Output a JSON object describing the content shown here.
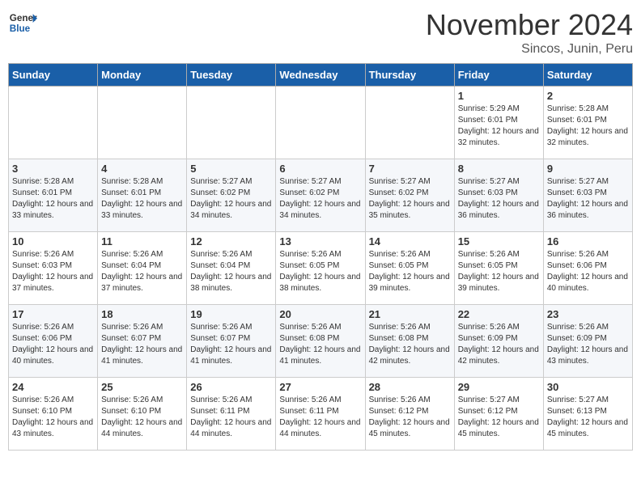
{
  "header": {
    "logo_general": "General",
    "logo_blue": "Blue",
    "month_title": "November 2024",
    "subtitle": "Sincos, Junin, Peru"
  },
  "days_of_week": [
    "Sunday",
    "Monday",
    "Tuesday",
    "Wednesday",
    "Thursday",
    "Friday",
    "Saturday"
  ],
  "weeks": [
    [
      {
        "day": "",
        "info": ""
      },
      {
        "day": "",
        "info": ""
      },
      {
        "day": "",
        "info": ""
      },
      {
        "day": "",
        "info": ""
      },
      {
        "day": "",
        "info": ""
      },
      {
        "day": "1",
        "info": "Sunrise: 5:29 AM\nSunset: 6:01 PM\nDaylight: 12 hours and 32 minutes."
      },
      {
        "day": "2",
        "info": "Sunrise: 5:28 AM\nSunset: 6:01 PM\nDaylight: 12 hours and 32 minutes."
      }
    ],
    [
      {
        "day": "3",
        "info": "Sunrise: 5:28 AM\nSunset: 6:01 PM\nDaylight: 12 hours and 33 minutes."
      },
      {
        "day": "4",
        "info": "Sunrise: 5:28 AM\nSunset: 6:01 PM\nDaylight: 12 hours and 33 minutes."
      },
      {
        "day": "5",
        "info": "Sunrise: 5:27 AM\nSunset: 6:02 PM\nDaylight: 12 hours and 34 minutes."
      },
      {
        "day": "6",
        "info": "Sunrise: 5:27 AM\nSunset: 6:02 PM\nDaylight: 12 hours and 34 minutes."
      },
      {
        "day": "7",
        "info": "Sunrise: 5:27 AM\nSunset: 6:02 PM\nDaylight: 12 hours and 35 minutes."
      },
      {
        "day": "8",
        "info": "Sunrise: 5:27 AM\nSunset: 6:03 PM\nDaylight: 12 hours and 36 minutes."
      },
      {
        "day": "9",
        "info": "Sunrise: 5:27 AM\nSunset: 6:03 PM\nDaylight: 12 hours and 36 minutes."
      }
    ],
    [
      {
        "day": "10",
        "info": "Sunrise: 5:26 AM\nSunset: 6:03 PM\nDaylight: 12 hours and 37 minutes."
      },
      {
        "day": "11",
        "info": "Sunrise: 5:26 AM\nSunset: 6:04 PM\nDaylight: 12 hours and 37 minutes."
      },
      {
        "day": "12",
        "info": "Sunrise: 5:26 AM\nSunset: 6:04 PM\nDaylight: 12 hours and 38 minutes."
      },
      {
        "day": "13",
        "info": "Sunrise: 5:26 AM\nSunset: 6:05 PM\nDaylight: 12 hours and 38 minutes."
      },
      {
        "day": "14",
        "info": "Sunrise: 5:26 AM\nSunset: 6:05 PM\nDaylight: 12 hours and 39 minutes."
      },
      {
        "day": "15",
        "info": "Sunrise: 5:26 AM\nSunset: 6:05 PM\nDaylight: 12 hours and 39 minutes."
      },
      {
        "day": "16",
        "info": "Sunrise: 5:26 AM\nSunset: 6:06 PM\nDaylight: 12 hours and 40 minutes."
      }
    ],
    [
      {
        "day": "17",
        "info": "Sunrise: 5:26 AM\nSunset: 6:06 PM\nDaylight: 12 hours and 40 minutes."
      },
      {
        "day": "18",
        "info": "Sunrise: 5:26 AM\nSunset: 6:07 PM\nDaylight: 12 hours and 41 minutes."
      },
      {
        "day": "19",
        "info": "Sunrise: 5:26 AM\nSunset: 6:07 PM\nDaylight: 12 hours and 41 minutes."
      },
      {
        "day": "20",
        "info": "Sunrise: 5:26 AM\nSunset: 6:08 PM\nDaylight: 12 hours and 41 minutes."
      },
      {
        "day": "21",
        "info": "Sunrise: 5:26 AM\nSunset: 6:08 PM\nDaylight: 12 hours and 42 minutes."
      },
      {
        "day": "22",
        "info": "Sunrise: 5:26 AM\nSunset: 6:09 PM\nDaylight: 12 hours and 42 minutes."
      },
      {
        "day": "23",
        "info": "Sunrise: 5:26 AM\nSunset: 6:09 PM\nDaylight: 12 hours and 43 minutes."
      }
    ],
    [
      {
        "day": "24",
        "info": "Sunrise: 5:26 AM\nSunset: 6:10 PM\nDaylight: 12 hours and 43 minutes."
      },
      {
        "day": "25",
        "info": "Sunrise: 5:26 AM\nSunset: 6:10 PM\nDaylight: 12 hours and 44 minutes."
      },
      {
        "day": "26",
        "info": "Sunrise: 5:26 AM\nSunset: 6:11 PM\nDaylight: 12 hours and 44 minutes."
      },
      {
        "day": "27",
        "info": "Sunrise: 5:26 AM\nSunset: 6:11 PM\nDaylight: 12 hours and 44 minutes."
      },
      {
        "day": "28",
        "info": "Sunrise: 5:26 AM\nSunset: 6:12 PM\nDaylight: 12 hours and 45 minutes."
      },
      {
        "day": "29",
        "info": "Sunrise: 5:27 AM\nSunset: 6:12 PM\nDaylight: 12 hours and 45 minutes."
      },
      {
        "day": "30",
        "info": "Sunrise: 5:27 AM\nSunset: 6:13 PM\nDaylight: 12 hours and 45 minutes."
      }
    ]
  ]
}
